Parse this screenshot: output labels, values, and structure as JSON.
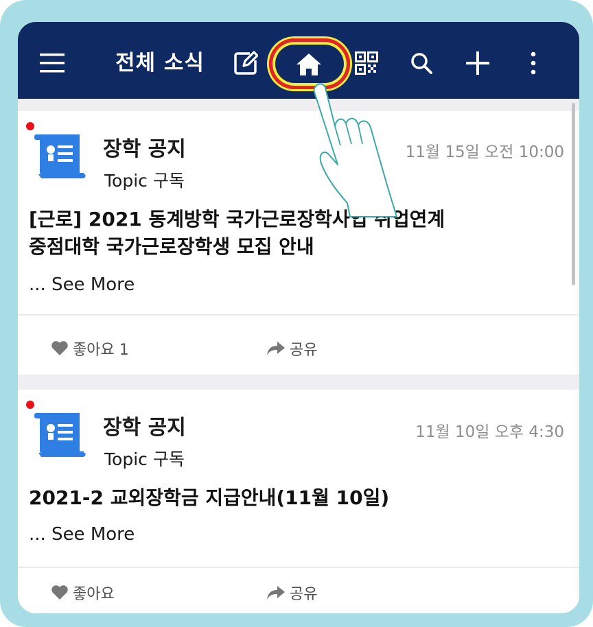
{
  "header": {
    "title": "전체 소식",
    "menu_icon": "hamburger-menu-icon",
    "compose_icon": "compose-icon",
    "home_icon": "home-icon",
    "qr_icon": "qr-code-icon",
    "search_icon": "search-icon",
    "add_icon": "plus-icon",
    "more_icon": "vertical-more-icon"
  },
  "colors": {
    "header_bg": "#0f2a63",
    "frame": "#a9dde6",
    "highlight_ring": "#e32426",
    "highlight_glow": "#f6ec3d",
    "unread_dot": "#e8121b",
    "doc_icon": "#2f7ee4"
  },
  "posts": [
    {
      "channel": "장학 공지",
      "subtitle": "Topic 구독",
      "time": "11월 15일 오전 10:00",
      "title_lines": [
        "[근로] 2021 동계방학 국가근로장학사업 취업연계",
        "중점대학 국가근로장학생 모집 안내"
      ],
      "see_more": "... See More",
      "like_label": "좋아요 1",
      "share_label": "공유"
    },
    {
      "channel": "장학 공지",
      "subtitle": "Topic 구독",
      "time": "11월 10일 오후 4:30",
      "title_lines": [
        "2021-2 교외장학금 지급안내(11월 10일)"
      ],
      "see_more": "... See More",
      "like_label": "좋아요",
      "share_label": "공유"
    }
  ]
}
